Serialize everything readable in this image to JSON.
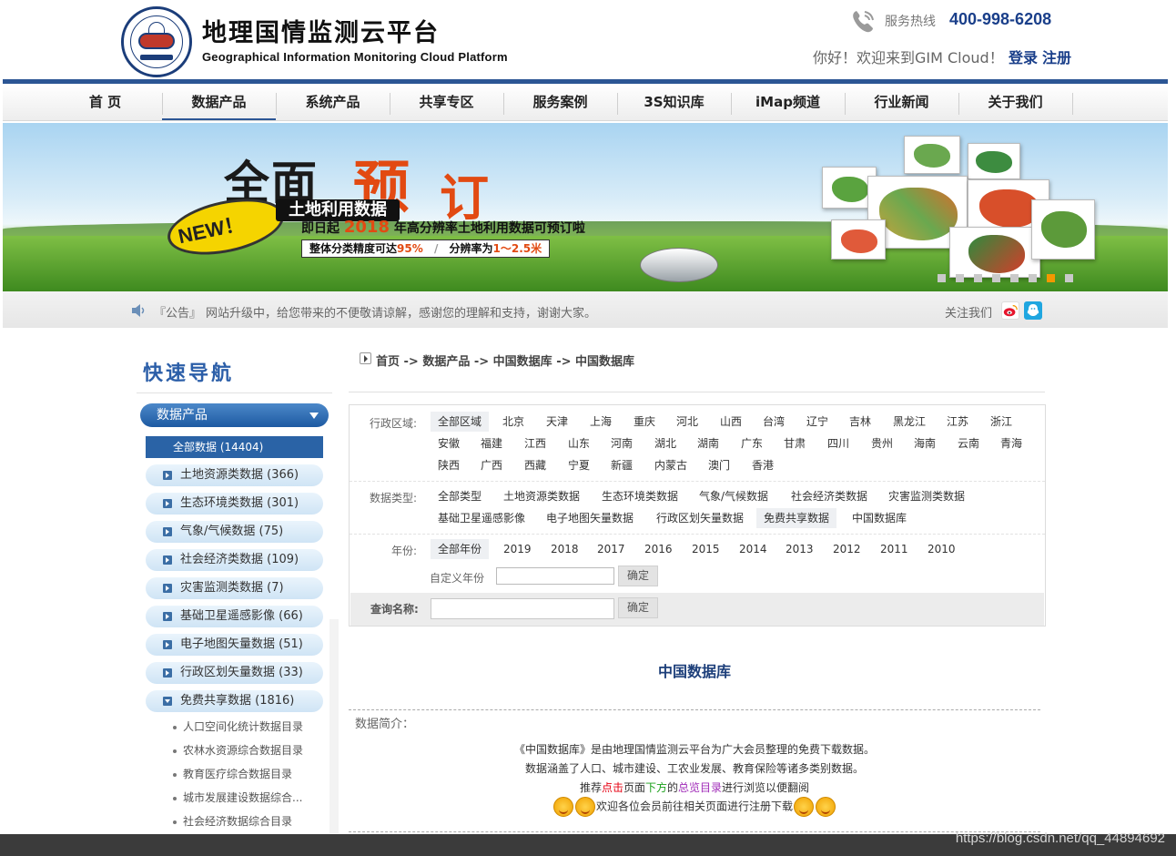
{
  "header": {
    "logo_text": "GIM Cloud",
    "title": "地理国情监测云平台",
    "subtitle": "Geographical Information Monitoring Cloud Platform",
    "hotline_label": "服务热线",
    "hotline_number": "400-998-6208",
    "welcome": "你好！欢迎来到GIM Cloud！",
    "login_label": "登录",
    "register_label": "注册"
  },
  "nav": {
    "items": [
      {
        "label": "首 页"
      },
      {
        "label": "数据产品"
      },
      {
        "label": "系统产品"
      },
      {
        "label": "共享专区"
      },
      {
        "label": "服务案例"
      },
      {
        "label": "3S知识库"
      },
      {
        "label": "iMap频道"
      },
      {
        "label": "行业新闻"
      },
      {
        "label": "关于我们"
      }
    ],
    "active_index": 1
  },
  "banner": {
    "headline_black": "全面",
    "headline_red1": "预",
    "headline_red2": "订",
    "new_badge": "NEW！",
    "subhead": "土地利用数据",
    "line2_prefix": "即日起",
    "line2_year": "2018",
    "line2_suffix": "年高分辨率土地利用数据可预订啦",
    "badge_accuracy_prefix": "整体分类精度可达",
    "badge_accuracy_value": "95%",
    "badge_resolution_prefix": "分辨率为",
    "badge_resolution_value": "1～2.5米",
    "slide_count": 8,
    "active_slide": 6,
    "colors": {
      "accent": "#e24a12",
      "active_dot": "#f39800"
    }
  },
  "notice": {
    "label": "『公告』",
    "text": "网站升级中，给您带来的不便敬请谅解，感谢您的理解和支持，谢谢大家。",
    "follow_label": "关注我们"
  },
  "sidebar": {
    "title": "快速导航",
    "category_header": "数据产品",
    "all_item": "全部数据 (14404)",
    "items": [
      {
        "label": "土地资源类数据 (366)"
      },
      {
        "label": "生态环境类数据 (301)"
      },
      {
        "label": "气象/气候数据 (75)"
      },
      {
        "label": "社会经济类数据 (109)"
      },
      {
        "label": "灾害监测类数据 (7)"
      },
      {
        "label": "基础卫星遥感影像 (66)"
      },
      {
        "label": "电子地图矢量数据 (51)"
      },
      {
        "label": "行政区划矢量数据 (33)"
      },
      {
        "label": "免费共享数据 (1816)"
      }
    ],
    "sub_items": [
      {
        "label": "人口空间化统计数据目录"
      },
      {
        "label": "农林水资源综合数据目录"
      },
      {
        "label": "教育医疗综合数据目录"
      },
      {
        "label": "城市发展建设数据综合..."
      },
      {
        "label": "社会经济数据综合目录"
      }
    ]
  },
  "main": {
    "breadcrumb": "首页 -> 数据产品 -> 中国数据库 -> 中国数据库",
    "filters": {
      "region_label": "行政区域:",
      "regions_row1": [
        "全部区域",
        "北京",
        "天津",
        "上海",
        "重庆",
        "河北",
        "山西",
        "台湾",
        "辽宁",
        "吉林",
        "黑龙江",
        "江苏",
        "浙江"
      ],
      "regions_row2": [
        "安徽",
        "福建",
        "江西",
        "山东",
        "河南",
        "湖北",
        "湖南",
        "广东",
        "甘肃",
        "四川",
        "贵州",
        "海南",
        "云南",
        "青海"
      ],
      "regions_row3": [
        "陕西",
        "广西",
        "西藏",
        "宁夏",
        "新疆",
        "内蒙古",
        "澳门",
        "香港"
      ],
      "type_label": "数据类型:",
      "types_row1": [
        "全部类型",
        "土地资源类数据",
        "生态环境类数据",
        "气象/气候数据",
        "社会经济类数据",
        "灾害监测类数据"
      ],
      "types_row2": [
        "基础卫星遥感影像",
        "电子地图矢量数据",
        "行政区划矢量数据",
        "免费共享数据",
        "中国数据库"
      ],
      "year_label": "年份:",
      "years": [
        "全部年份",
        "2019",
        "2018",
        "2017",
        "2016",
        "2015",
        "2014",
        "2013",
        "2012",
        "2011",
        "2010"
      ],
      "custom_year_label": "自定义年份",
      "custom_year_value": "",
      "confirm_label": "确定",
      "query_label": "查询名称:",
      "query_value": "",
      "query_confirm_label": "确定"
    },
    "db_title": "中国数据库",
    "intro_label": "数据简介：",
    "intro_line1": "《中国数据库》是由地理国情监测云平台为广大会员整理的免费下载数据。",
    "intro_line2": "数据涵盖了人口、城市建设、工农业发展、教育保险等诸多类别数据。",
    "intro_line3_a": "推荐",
    "intro_line3_b": "点击",
    "intro_line3_c": "页面",
    "intro_line3_d": "下方",
    "intro_line3_e": "的",
    "intro_line3_f": "总览目录",
    "intro_line3_g": "进行浏览以便翻阅",
    "intro_line4": "欢迎各位会员前往相关页面进行注册下载"
  },
  "watermark": "https://blog.csdn.net/qq_44894692"
}
